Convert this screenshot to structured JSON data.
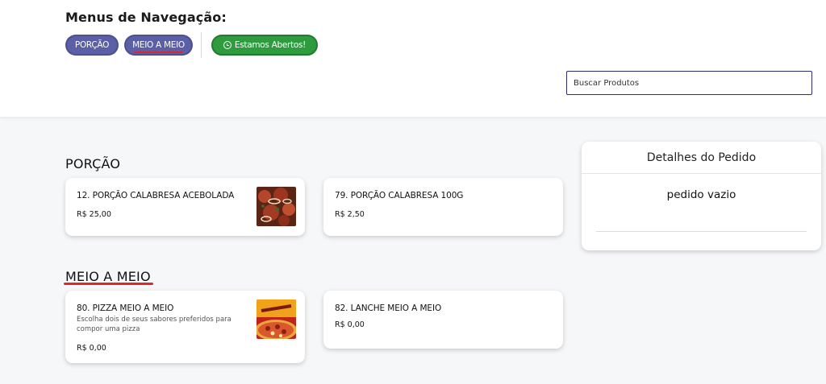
{
  "nav": {
    "title": "Menus de Navegação:",
    "pills": [
      {
        "label": "PORÇÃO"
      },
      {
        "label": "MEIO A MEIO"
      }
    ],
    "status_label": "Estamos Abertos!",
    "status_icon": "clock-icon",
    "colors": {
      "pill": "#5b5fa5",
      "status": "#2e9b3e",
      "accent_underline": "#e0262b"
    }
  },
  "search": {
    "placeholder": "Buscar Produtos",
    "value": ""
  },
  "sections": [
    {
      "title": "PORÇÃO",
      "products": [
        {
          "name": "12. PORÇÃO CALABRESA ACEBOLADA",
          "price": "R$ 25,00",
          "has_image": true
        },
        {
          "name": "79. PORÇÃO CALABRESA 100G",
          "price": "R$ 2,50",
          "has_image": false
        }
      ]
    },
    {
      "title": "MEIO A MEIO",
      "products": [
        {
          "name": "80. PIZZA MEIO A MEIO",
          "description": "Escolha dois de seus sabores preferidos para compor uma pizza",
          "price": "R$ 0,00",
          "has_image": true
        },
        {
          "name": "82. LANCHE MEIO A MEIO",
          "price": "R$ 0,00",
          "has_image": false
        }
      ]
    }
  ],
  "order": {
    "title": "Detalhes do Pedido",
    "empty_text": "pedido vazio"
  }
}
